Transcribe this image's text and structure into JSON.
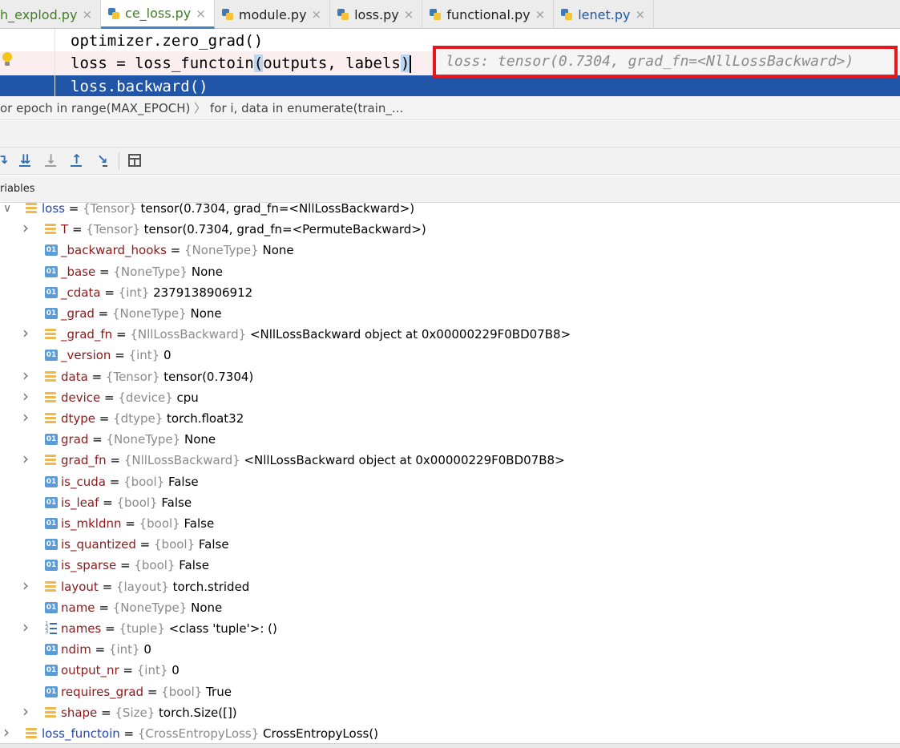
{
  "tabs": [
    {
      "label": "h_explod.py",
      "color": "green",
      "active": false,
      "icon": false
    },
    {
      "label": "ce_loss.py",
      "color": "green",
      "active": true,
      "icon": true
    },
    {
      "label": "module.py",
      "color": "black",
      "active": false,
      "icon": true
    },
    {
      "label": "loss.py",
      "color": "black",
      "active": false,
      "icon": true
    },
    {
      "label": "functional.py",
      "color": "black",
      "active": false,
      "icon": true
    },
    {
      "label": "lenet.py",
      "color": "blue",
      "active": false,
      "icon": true
    }
  ],
  "tab_close_glyph": "×",
  "editor": {
    "line1": "optimizer.zero_grad()",
    "line2_before": "loss = loss_functoin",
    "line2_open": "(",
    "line2_args": "outputs, labels",
    "line2_close": ")",
    "line3": "loss.backward()",
    "inline_value": "loss: tensor(0.7304, grad_fn=<NllLossBackward>)"
  },
  "breadcrumb": {
    "item1": "or epoch in range(MAX_EPOCH)",
    "item2": "for i, data in enumerate(train_...",
    "separator": "〉"
  },
  "toolbar": {
    "icons": [
      "step-over-icon",
      "step-into-icon",
      "step-into-my-code-icon",
      "step-out-icon",
      "run-to-cursor-icon",
      "evaluate-expression-icon"
    ]
  },
  "variables_header": "riables",
  "variables": [
    {
      "name": "loss",
      "type": "{Tensor}",
      "value": "tensor(0.7304, grad_fn=<NllLossBackward>)",
      "icon": "obj",
      "expand": "open",
      "level": 0,
      "blue": true
    },
    {
      "name": "T",
      "type": "{Tensor}",
      "value": "tensor(0.7304, grad_fn=<PermuteBackward>)",
      "icon": "obj",
      "expand": "closed",
      "level": 1
    },
    {
      "name": "_backward_hooks",
      "type": "{NoneType}",
      "value": "None",
      "icon": "field",
      "expand": "none",
      "level": 1
    },
    {
      "name": "_base",
      "type": "{NoneType}",
      "value": "None",
      "icon": "field",
      "expand": "none",
      "level": 1
    },
    {
      "name": "_cdata",
      "type": "{int}",
      "value": "2379138906912",
      "icon": "field",
      "expand": "none",
      "level": 1
    },
    {
      "name": "_grad",
      "type": "{NoneType}",
      "value": "None",
      "icon": "field",
      "expand": "none",
      "level": 1
    },
    {
      "name": "_grad_fn",
      "type": "{NllLossBackward}",
      "value": "<NllLossBackward object at 0x00000229F0BD07B8>",
      "icon": "obj",
      "expand": "closed",
      "level": 1
    },
    {
      "name": "_version",
      "type": "{int}",
      "value": "0",
      "icon": "field",
      "expand": "none",
      "level": 1
    },
    {
      "name": "data",
      "type": "{Tensor}",
      "value": "tensor(0.7304)",
      "icon": "obj",
      "expand": "closed",
      "level": 1
    },
    {
      "name": "device",
      "type": "{device}",
      "value": "cpu",
      "icon": "obj",
      "expand": "closed",
      "level": 1
    },
    {
      "name": "dtype",
      "type": "{dtype}",
      "value": "torch.float32",
      "icon": "obj",
      "expand": "closed",
      "level": 1
    },
    {
      "name": "grad",
      "type": "{NoneType}",
      "value": "None",
      "icon": "field",
      "expand": "none",
      "level": 1
    },
    {
      "name": "grad_fn",
      "type": "{NllLossBackward}",
      "value": "<NllLossBackward object at 0x00000229F0BD07B8>",
      "icon": "obj",
      "expand": "closed",
      "level": 1
    },
    {
      "name": "is_cuda",
      "type": "{bool}",
      "value": "False",
      "icon": "field",
      "expand": "none",
      "level": 1
    },
    {
      "name": "is_leaf",
      "type": "{bool}",
      "value": "False",
      "icon": "field",
      "expand": "none",
      "level": 1
    },
    {
      "name": "is_mkldnn",
      "type": "{bool}",
      "value": "False",
      "icon": "field",
      "expand": "none",
      "level": 1
    },
    {
      "name": "is_quantized",
      "type": "{bool}",
      "value": "False",
      "icon": "field",
      "expand": "none",
      "level": 1
    },
    {
      "name": "is_sparse",
      "type": "{bool}",
      "value": "False",
      "icon": "field",
      "expand": "none",
      "level": 1
    },
    {
      "name": "layout",
      "type": "{layout}",
      "value": "torch.strided",
      "icon": "obj",
      "expand": "closed",
      "level": 1
    },
    {
      "name": "name",
      "type": "{NoneType}",
      "value": "None",
      "icon": "field",
      "expand": "none",
      "level": 1
    },
    {
      "name": "names",
      "type": "{tuple}",
      "value": "<class 'tuple'>: ()",
      "icon": "list",
      "expand": "closed",
      "level": 1
    },
    {
      "name": "ndim",
      "type": "{int}",
      "value": "0",
      "icon": "field",
      "expand": "none",
      "level": 1
    },
    {
      "name": "output_nr",
      "type": "{int}",
      "value": "0",
      "icon": "field",
      "expand": "none",
      "level": 1
    },
    {
      "name": "requires_grad",
      "type": "{bool}",
      "value": "True",
      "icon": "field",
      "expand": "none",
      "level": 1
    },
    {
      "name": "shape",
      "type": "{Size}",
      "value": "torch.Size([])",
      "icon": "obj",
      "expand": "closed",
      "level": 1
    },
    {
      "name": "loss_functoin",
      "type": "{CrossEntropyLoss}",
      "value": "CrossEntropyLoss()",
      "icon": "obj",
      "expand": "closed",
      "level": 0,
      "blue": true
    }
  ],
  "colors": {
    "selection": "#2155a8",
    "hint_border": "#e3191e",
    "var_name": "#8b1a1a",
    "var_name_top": "#2446b0",
    "type_gray": "#8a8a8a"
  }
}
